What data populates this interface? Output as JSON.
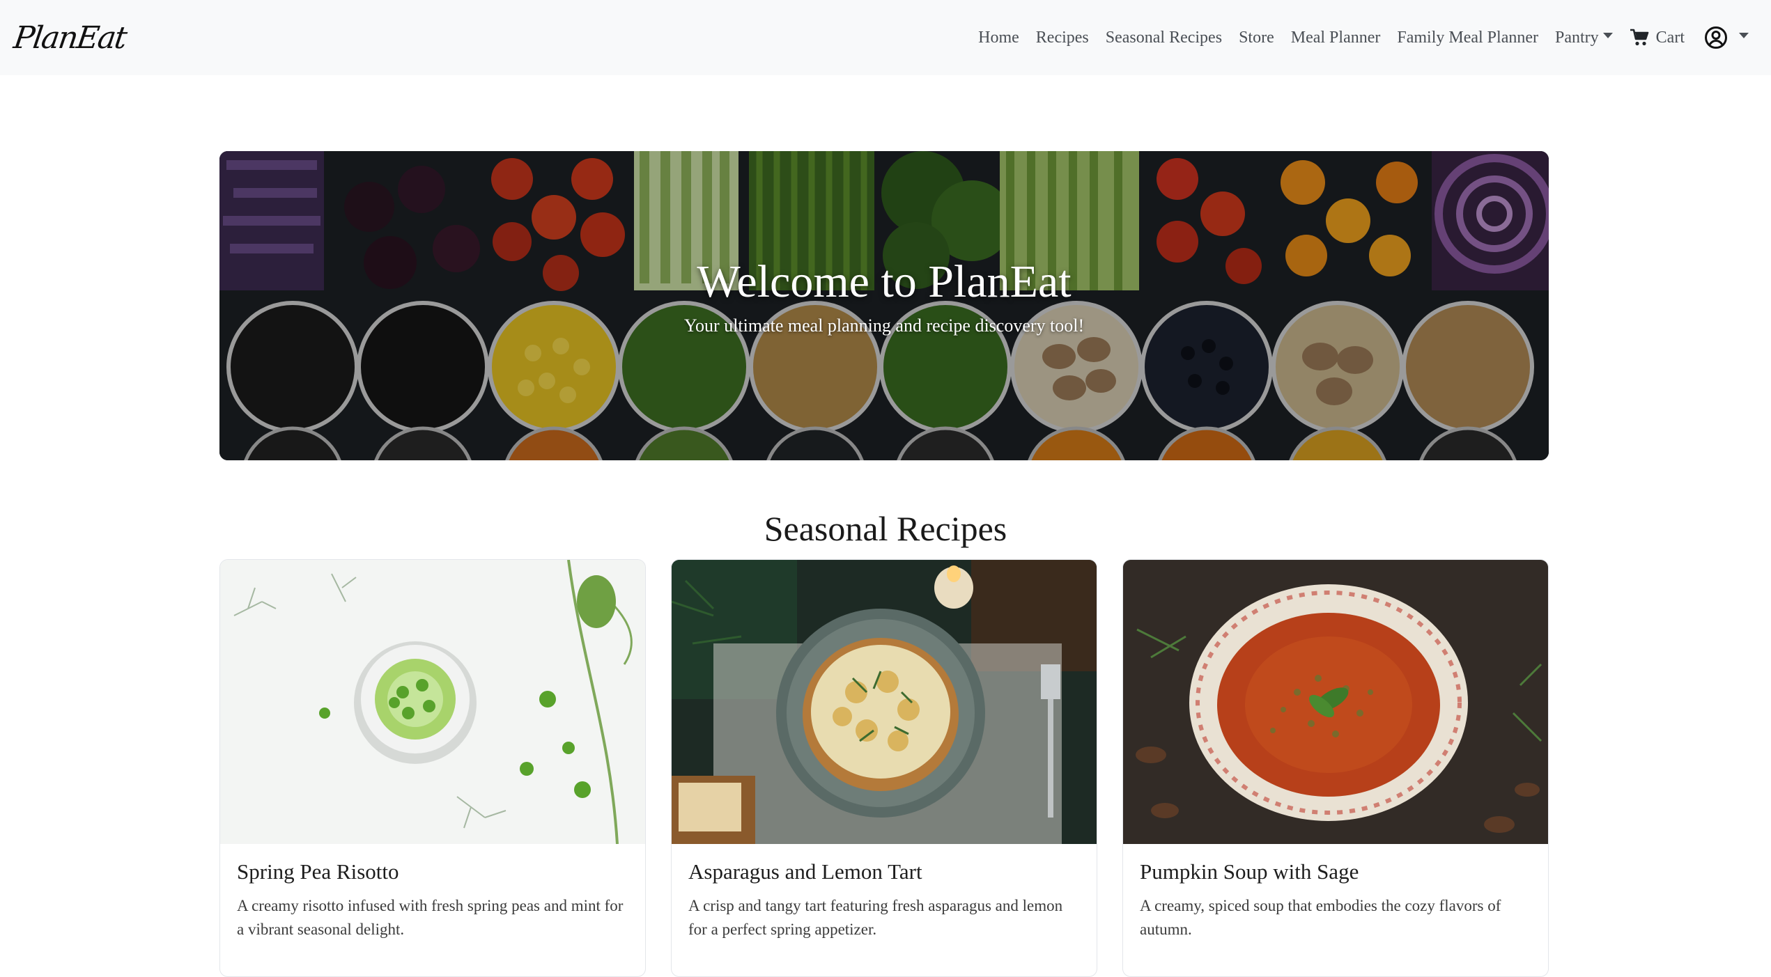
{
  "brand": {
    "logo": "PlanEat"
  },
  "nav": {
    "items": [
      {
        "label": "Home"
      },
      {
        "label": "Recipes"
      },
      {
        "label": "Seasonal Recipes"
      },
      {
        "label": "Store"
      },
      {
        "label": "Meal Planner"
      },
      {
        "label": "Family Meal Planner"
      }
    ],
    "pantry": "Pantry",
    "cart": "Cart",
    "icons": {
      "cart": "cart-icon",
      "user": "user-circle-icon",
      "dropdown": "caret-down-icon"
    }
  },
  "hero": {
    "title": "Welcome to PlanEat",
    "subtitle": "Your ultimate meal planning and recipe discovery tool!"
  },
  "seasonal": {
    "heading": "Seasonal Recipes",
    "recipes": [
      {
        "title": "Spring Pea Risotto",
        "description": "A creamy risotto infused with fresh spring peas and mint for a vibrant seasonal delight."
      },
      {
        "title": "Asparagus and Lemon Tart",
        "description": "A crisp and tangy tart featuring fresh asparagus and lemon for a perfect spring appetizer."
      },
      {
        "title": "Pumpkin Soup with Sage",
        "description": "A creamy, spiced soup that embodies the cozy flavors of autumn."
      }
    ]
  },
  "colors": {
    "navbar_bg": "#f8f9fa",
    "nav_text": "#4a4f55",
    "page_bg": "#ffffff"
  }
}
